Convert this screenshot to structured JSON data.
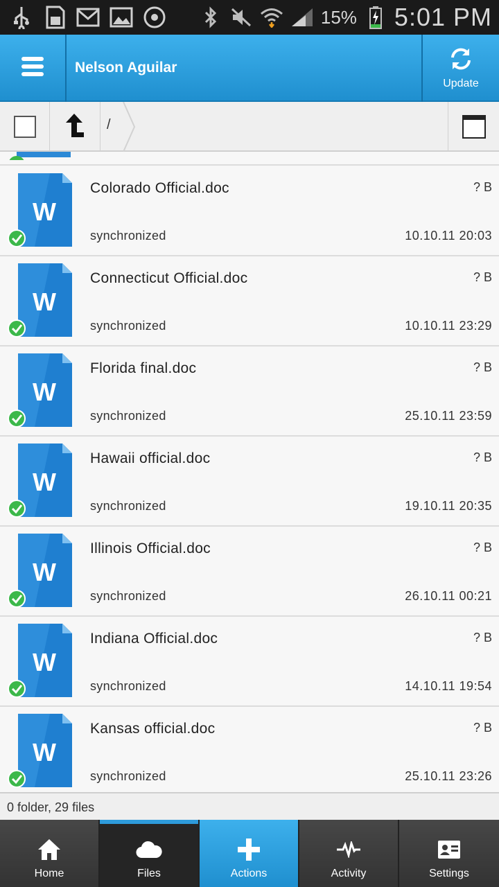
{
  "status_bar": {
    "battery_percent": "15%",
    "time": "5:01 PM",
    "left_icons": [
      "usb-icon",
      "sd-card-icon",
      "gmail-icon",
      "gallery-icon",
      "sync-circle-icon"
    ],
    "right_icons": [
      "bluetooth-icon",
      "mute-icon",
      "wifi-icon",
      "signal-icon",
      "battery-charging-icon"
    ]
  },
  "action_bar": {
    "title": "Nelson Aguilar",
    "update_label": "Update"
  },
  "toolbar": {
    "path": "/"
  },
  "files": [
    {
      "name": "Colorado Official.doc",
      "size": "? B",
      "status": "synchronized",
      "date": "10.10.11 20:03"
    },
    {
      "name": "Connecticut Official.doc",
      "size": "? B",
      "status": "synchronized",
      "date": "10.10.11 23:29"
    },
    {
      "name": "Florida final.doc",
      "size": "? B",
      "status": "synchronized",
      "date": "25.10.11 23:59"
    },
    {
      "name": "Hawaii official.doc",
      "size": "? B",
      "status": "synchronized",
      "date": "19.10.11 20:35"
    },
    {
      "name": "Illinois Official.doc",
      "size": "? B",
      "status": "synchronized",
      "date": "26.10.11 00:21"
    },
    {
      "name": "Indiana Official.doc",
      "size": "? B",
      "status": "synchronized",
      "date": "14.10.11 19:54"
    },
    {
      "name": "Kansas official.doc",
      "size": "? B",
      "status": "synchronized",
      "date": "25.10.11 23:26"
    }
  ],
  "summary": "0 folder, 29 files",
  "bottom_nav": [
    {
      "label": "Home",
      "icon": "home-icon"
    },
    {
      "label": "Files",
      "icon": "cloud-icon"
    },
    {
      "label": "Actions",
      "icon": "plus-icon"
    },
    {
      "label": "Activity",
      "icon": "pulse-icon"
    },
    {
      "label": "Settings",
      "icon": "id-card-icon"
    }
  ],
  "colors": {
    "accent": "#2e9bdb",
    "action_bar": "#1f8fcf",
    "sync_check": "#3cb84a"
  }
}
